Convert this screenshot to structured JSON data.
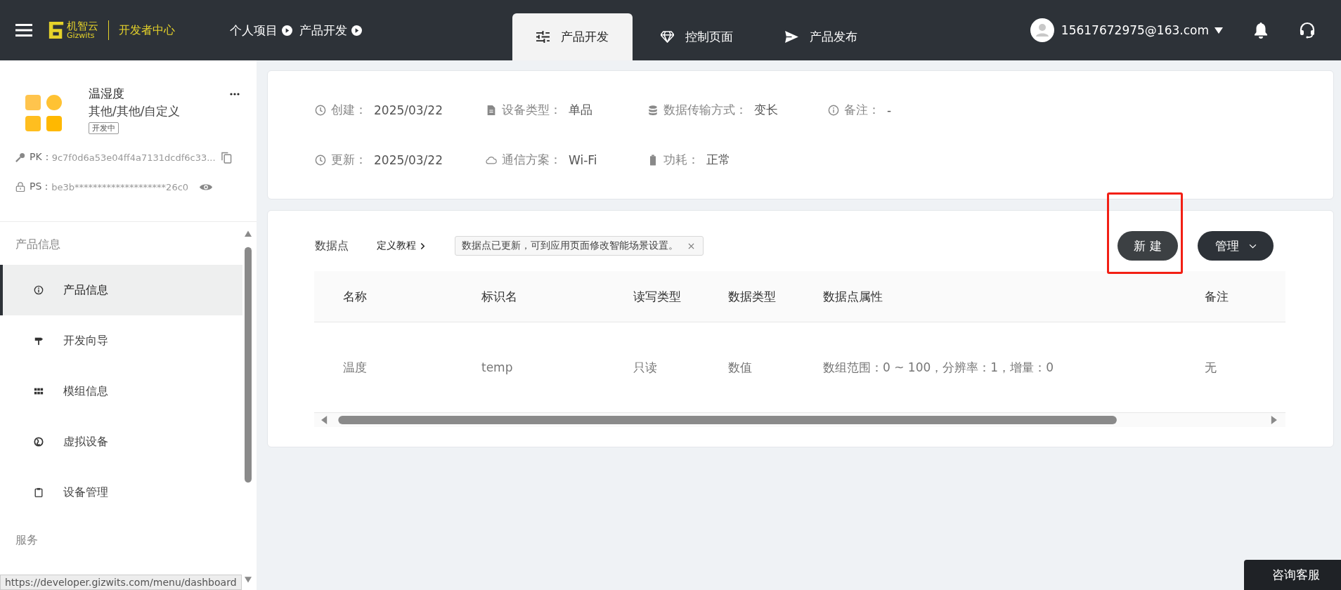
{
  "top_bar": {
    "logo_name": "机智云",
    "logo_sub": "Gizwits",
    "portal": "开发者中心",
    "breadcrumb": [
      "个人项目",
      "产品开发"
    ],
    "tabs": [
      {
        "label": "产品开发",
        "kind": "sliders",
        "selected": true
      },
      {
        "label": "控制页面",
        "kind": "diamond",
        "selected": false
      },
      {
        "label": "产品发布",
        "kind": "send",
        "selected": false
      }
    ],
    "user": "15617672975@163.com"
  },
  "product": {
    "name": "温湿度",
    "category": "其他/其他/自定义",
    "status": "开发中",
    "pk_label": "PK：",
    "pk": "9c7f0d6a53e04ff4a7131dcdf6c33...",
    "ps_label": "PS：",
    "ps": "be3b********************26c0"
  },
  "sidebar": {
    "section": "产品信息",
    "items": [
      {
        "label": "产品信息",
        "kind": "info",
        "selected": true
      },
      {
        "label": "开发向导",
        "kind": "signpost",
        "selected": false
      },
      {
        "label": "模组信息",
        "kind": "grid",
        "selected": false
      },
      {
        "label": "虚拟设备",
        "kind": "globe",
        "selected": false
      },
      {
        "label": "设备管理",
        "kind": "clipboard",
        "selected": false
      }
    ],
    "section_2": "服务"
  },
  "info_rows": [
    [
      {
        "kind": "clock",
        "label": "创建：",
        "value": "2025/03/22"
      },
      {
        "kind": "file",
        "label": "设备类型：",
        "value": "单品"
      },
      {
        "kind": "database",
        "label": "数据传输方式：",
        "value": "变长"
      },
      {
        "kind": "info",
        "label": "备注：",
        "value": "-"
      }
    ],
    [
      {
        "kind": "clock",
        "label": "更新：",
        "value": "2025/03/22"
      },
      {
        "kind": "cloud",
        "label": "通信方案：",
        "value": "Wi-Fi"
      },
      {
        "kind": "battery",
        "label": "功耗：",
        "value": "正常"
      }
    ]
  ],
  "datapoints": {
    "title": "数据点",
    "tutorial": "定义教程",
    "notice": "数据点已更新，可到应用页面修改智能场景设置。",
    "new_button": "新 建",
    "manage_button": "管理",
    "columns": [
      "名称",
      "标识名",
      "读写类型",
      "数据类型",
      "数据点属性",
      "备注"
    ],
    "rows": [
      [
        "温度",
        "temp",
        "只读",
        "数值",
        "数组范围：0 ~ 100，分辨率：1，增量：0",
        "无"
      ]
    ]
  },
  "status_url": "https://developer.gizwits.com/menu/dashboard",
  "support_button": "咨询客服"
}
